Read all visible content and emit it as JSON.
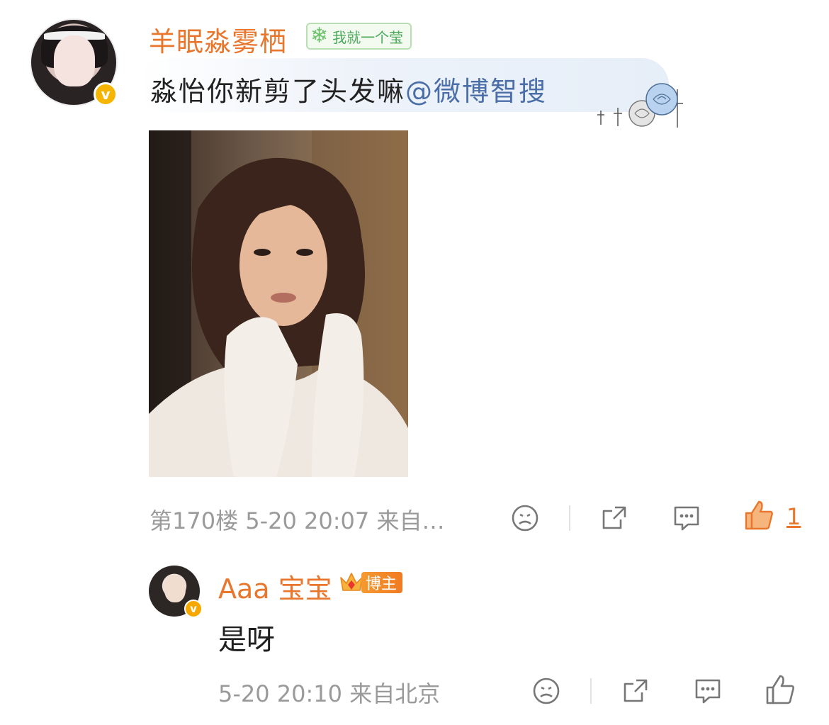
{
  "comment": {
    "username": "羊眠淼雾栖",
    "fan_badge": "我就一个莹",
    "text": "淼怡你新剪了头发嘛",
    "mention": "@微博智搜",
    "floor_meta": "第170楼  5-20 20:07  来自…",
    "like_count": "1"
  },
  "reply": {
    "username": "Aaa 宝宝",
    "role_badge": "博主",
    "text": "是呀",
    "meta": "5-20 20:10  来自北京"
  },
  "colors": {
    "username": "#e8762d",
    "mention": "#4b6ea8",
    "meta": "#9a9a9a",
    "verified": "#f6b500"
  },
  "icons": [
    "dislike-face-icon",
    "share-icon",
    "comment-icon",
    "like-thumb-icon",
    "verified-icon",
    "snowflake-icon",
    "crown-icon"
  ]
}
